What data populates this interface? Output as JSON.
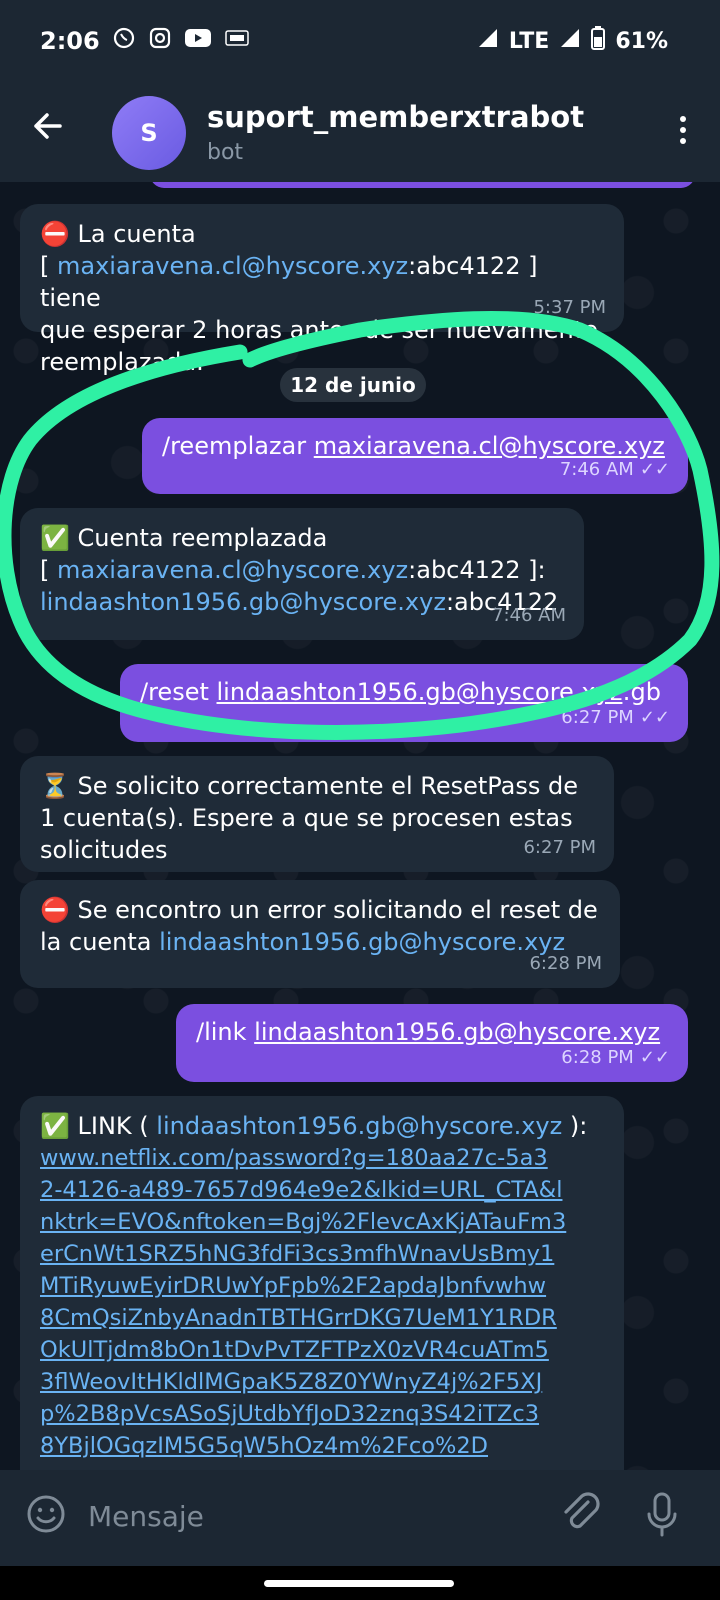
{
  "status": {
    "time": "2:06",
    "network": "LTE",
    "battery": "61%"
  },
  "header": {
    "title": "suport_memberxtrabot",
    "subtitle": "bot",
    "avatar": "S"
  },
  "chat": {
    "date_label": "12 de junio",
    "msg1": {
      "icon": "⛔",
      "line1": "La cuenta",
      "line2_pre": "[ ",
      "email": "maxiaravena.cl@hyscore.xyz",
      "line2_post": ":abc4122 ] tiene",
      "line3": "que esperar 2 horas antes de ser nuevamente",
      "line4": "reemplazada.",
      "time": "5:37 PM"
    },
    "msg2": {
      "cmd": "/reemplazar ",
      "email": "maxiaravena.cl@hyscore.xyz",
      "time": "7:46 AM"
    },
    "msg3": {
      "icon": "✅",
      "line1": "Cuenta reemplazada",
      "line2_pre": "[ ",
      "email1": "maxiaravena.cl@hyscore.xyz",
      "line2_post": ":abc4122 ]:",
      "email2": "lindaashton1956.gb@hyscore.xyz",
      "line3_post": ":abc4122",
      "time": "7:46 AM"
    },
    "msg4": {
      "cmd": "/reset ",
      "email": "lindaashton1956.gb@hyscore.xyz",
      "post": ":gb",
      "time": "6:27 PM"
    },
    "msg5": {
      "icon": "⏳",
      "line1": "Se solicito correctamente el ResetPass de",
      "line2": "1 cuenta(s). Espere a que se procesen estas",
      "line3": "solicitudes",
      "time": "6:27 PM"
    },
    "msg6": {
      "icon": "⛔",
      "line1": "Se encontro un error solicitando el reset de",
      "line2_pre": "la cuenta ",
      "email": "lindaashton1956.gb@hyscore.xyz",
      "time": "6:28 PM"
    },
    "msg7": {
      "cmd": "/link ",
      "email": "lindaashton1956.gb@hyscore.xyz",
      "time": "6:28 PM"
    },
    "msg8": {
      "icon": "✅",
      "pre": "LINK ( ",
      "email": "lindaashton1956.gb@hyscore.xyz",
      "post": " ):",
      "url_lines": [
        "www.netflix.com/password?g=180aa27c-5a3",
        "2-4126-a489-7657d964e9e2&lkid=URL_CTA&l",
        "nktrk=EVO&nftoken=Bgj%2FlevcAxKjATauFm3",
        "erCnWt1SRZ5hNG3fdFi3cs3mfhWnavUsBmy1",
        "MTiRyuwEyirDRUwYpFpb%2F2apdaJbnfvwhw",
        "8CmQsiZnbyAnadnTBTHGrrDKG7UeM1Y1RDR",
        "OkUlTjdm8bOn1tDvPvTZFTPzX0zVR4cuATm5",
        "3flWeovItHKldlMGpaK5Z8Z0YWnyZ4j%2F5XJ",
        "p%2B8pVcsASoSjUtdbYfJoD32znq3S42iTZc3",
        "8YBjlOGqzIM5G5qW5hOz4m%2Fco%2D"
      ]
    }
  },
  "input": {
    "placeholder": "Mensaje"
  },
  "colors": {
    "accent": "#7b4fe0",
    "link": "#6ab3f3",
    "highlight": "#2ff0a4"
  }
}
